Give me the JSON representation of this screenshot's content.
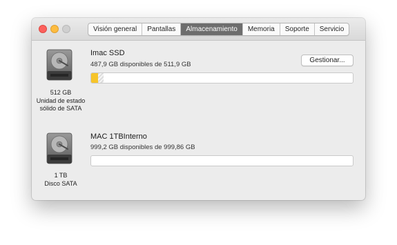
{
  "window": {
    "tabs": [
      {
        "label": "Visión general",
        "active": false
      },
      {
        "label": "Pantallas",
        "active": false
      },
      {
        "label": "Almacenamiento",
        "active": true
      },
      {
        "label": "Memoria",
        "active": false
      },
      {
        "label": "Soporte",
        "active": false
      },
      {
        "label": "Servicio",
        "active": false
      }
    ]
  },
  "drives": [
    {
      "icon": "hard-drive-icon",
      "caption_size": "512 GB",
      "caption_type_line1": "Unidad de estado",
      "caption_type_line2": "sólido de SATA",
      "name": "Imac SSD",
      "available": "487,9 GB disponibles de 511,9 GB",
      "used_fraction": 0.047,
      "manage_label": "Gestionar..."
    },
    {
      "icon": "hard-drive-icon",
      "caption_size": "1 TB",
      "caption_type_line1": "Disco SATA",
      "name": "MAC 1TBInterno",
      "available": "999,2 GB disponibles de 999,86 GB",
      "used_fraction": 0.0007
    }
  ],
  "colors": {
    "usage_apps": "#f6c42a",
    "active_tab": "#6d6d6d",
    "close": "#fc605c",
    "minimize": "#fdbc40"
  }
}
